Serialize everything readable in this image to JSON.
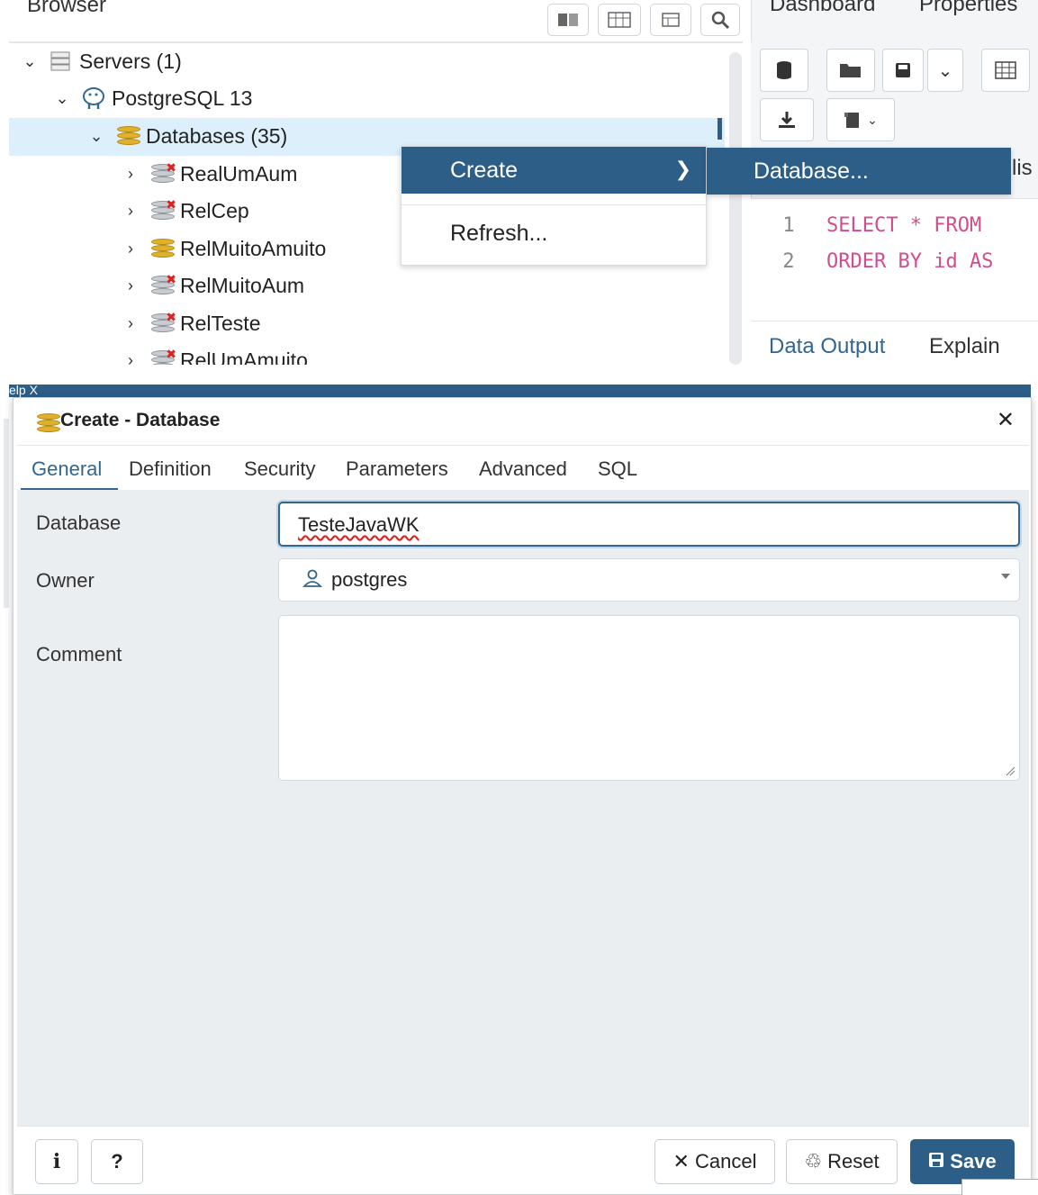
{
  "browser": {
    "title": "Browser",
    "tree": [
      {
        "label": "Servers (1)",
        "icon": "servers-icon"
      },
      {
        "label": "PostgreSQL 13",
        "icon": "elephant-icon"
      },
      {
        "label": "Databases (35)",
        "icon": "database-icon"
      },
      {
        "label": "RealUmAum",
        "icon": "database-disconnected-icon"
      },
      {
        "label": "RelCep",
        "icon": "database-disconnected-icon"
      },
      {
        "label": "RelMuitoAmuito",
        "icon": "database-icon"
      },
      {
        "label": "RelMuitoAum",
        "icon": "database-disconnected-icon"
      },
      {
        "label": "RelTeste",
        "icon": "database-disconnected-icon"
      },
      {
        "label": "RelUmAmuito",
        "icon": "database-disconnected-icon"
      }
    ]
  },
  "context_menu": {
    "create_label": "Create",
    "refresh_label": "Refresh...",
    "submenu_database_label": "Database..."
  },
  "right_panel": {
    "tabs": [
      "Dashboard",
      "Properties"
    ],
    "partial_text": "lis",
    "code": [
      {
        "num": "1",
        "text": "SELECT * FROM"
      },
      {
        "num": "2",
        "text": "ORDER BY id AS"
      }
    ],
    "output_tabs": [
      "Data Output",
      "Explain"
    ]
  },
  "dialog": {
    "behind_text": "elp X",
    "title": "Create - Database",
    "tabs": [
      "General",
      "Definition",
      "Security",
      "Parameters",
      "Advanced",
      "SQL"
    ],
    "active_tab": "General",
    "fields": {
      "database_label": "Database",
      "database_value": "TesteJavaWK",
      "owner_label": "Owner",
      "owner_value": "postgres",
      "comment_label": "Comment",
      "comment_value": ""
    },
    "footer": {
      "info_label": "i",
      "help_label": "?",
      "cancel_label": "Cancel",
      "reset_label": "Reset",
      "save_label": "Save"
    }
  },
  "colors": {
    "accent": "#2c5e87",
    "selected_row": "#dceffb",
    "tab_active": "#326690",
    "keyword": "#d14e8c"
  }
}
